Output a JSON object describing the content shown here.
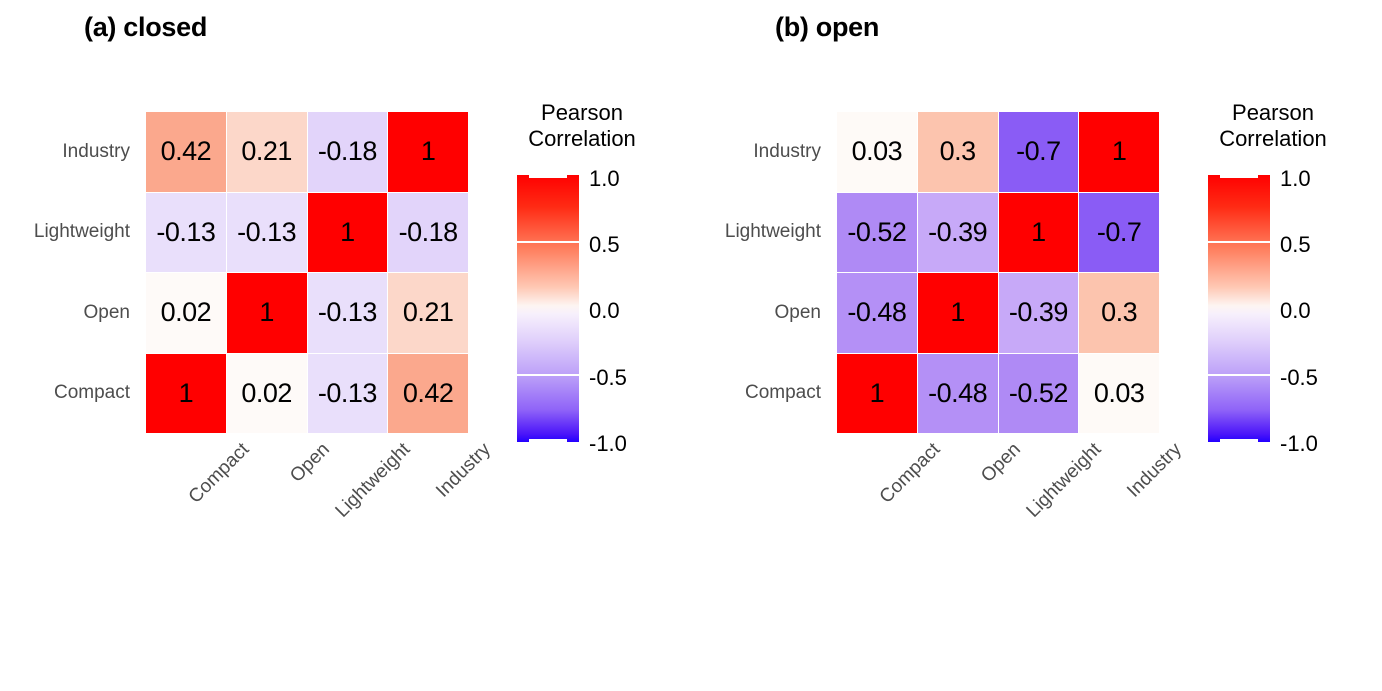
{
  "figure": {
    "background": "#ffffff",
    "panels": [
      {
        "id": "closed",
        "title": "(a) closed",
        "legend": {
          "title_line1": "Pearson",
          "title_line2": "Correlation",
          "ticks": [
            "1.0",
            "0.5",
            "0.0",
            "-0.5",
            "-1.0"
          ]
        }
      },
      {
        "id": "open",
        "title": "(b) open",
        "legend": {
          "title_line1": "Pearson",
          "title_line2": "Correlation",
          "ticks": [
            "1.0",
            "0.5",
            "0.0",
            "-0.5",
            "-1.0"
          ]
        }
      }
    ]
  },
  "chart_data": [
    {
      "type": "heatmap",
      "title": "(a) closed",
      "xlabel": "",
      "ylabel": "",
      "colorbar_label": "Pearson Correlation",
      "colorbar_range": [
        -1.0,
        1.0
      ],
      "colorbar_ticks": [
        1.0,
        0.5,
        0.0,
        -0.5,
        -1.0
      ],
      "colormap": "red-white-blue (positive=red, negative=blue/purple)",
      "x_categories": [
        "Compact",
        "Open",
        "Lightweight",
        "Industry"
      ],
      "y_categories": [
        "Industry",
        "Lightweight",
        "Open",
        "Compact"
      ],
      "rows": [
        {
          "label": "Industry",
          "values": [
            0.42,
            0.21,
            -0.18,
            1
          ],
          "display": [
            "0.42",
            "0.21",
            "-0.18",
            "1"
          ],
          "colors": [
            "#fba88d",
            "#fcd7c9",
            "#e2d4fa",
            "#ff0000"
          ]
        },
        {
          "label": "Lightweight",
          "values": [
            -0.13,
            -0.13,
            1,
            -0.18
          ],
          "display": [
            "-0.13",
            "-0.13",
            "1",
            "-0.18"
          ],
          "colors": [
            "#e9dffb",
            "#e9dffb",
            "#ff0000",
            "#e2d4fa"
          ]
        },
        {
          "label": "Open",
          "values": [
            0.02,
            1,
            -0.13,
            0.21
          ],
          "display": [
            "0.02",
            "1",
            "-0.13",
            "0.21"
          ],
          "colors": [
            "#fefaf8",
            "#ff0000",
            "#e9dffb",
            "#fcd7c9"
          ]
        },
        {
          "label": "Compact",
          "values": [
            1,
            0.02,
            -0.13,
            0.42
          ],
          "display": [
            "1",
            "0.02",
            "-0.13",
            "0.42"
          ],
          "colors": [
            "#ff0000",
            "#fefaf8",
            "#e9dffb",
            "#fba88d"
          ]
        }
      ]
    },
    {
      "type": "heatmap",
      "title": "(b) open",
      "xlabel": "",
      "ylabel": "",
      "colorbar_label": "Pearson Correlation",
      "colorbar_range": [
        -1.0,
        1.0
      ],
      "colorbar_ticks": [
        1.0,
        0.5,
        0.0,
        -0.5,
        -1.0
      ],
      "colormap": "red-white-blue (positive=red, negative=blue/purple)",
      "x_categories": [
        "Compact",
        "Open",
        "Lightweight",
        "Industry"
      ],
      "y_categories": [
        "Industry",
        "Lightweight",
        "Open",
        "Compact"
      ],
      "rows": [
        {
          "label": "Industry",
          "values": [
            0.03,
            0.3,
            -0.7,
            1
          ],
          "display": [
            "0.03",
            "0.3",
            "-0.7",
            "1"
          ],
          "colors": [
            "#fefaf7",
            "#fcc4ae",
            "#8a5cf5",
            "#ff0000"
          ]
        },
        {
          "label": "Lightweight",
          "values": [
            -0.52,
            -0.39,
            1,
            -0.7
          ],
          "display": [
            "-0.52",
            "-0.39",
            "1",
            "-0.7"
          ],
          "colors": [
            "#af8af5",
            "#c7a9f8",
            "#ff0000",
            "#8a5cf5"
          ]
        },
        {
          "label": "Open",
          "values": [
            -0.48,
            1,
            -0.39,
            0.3
          ],
          "display": [
            "-0.48",
            "1",
            "-0.39",
            "0.3"
          ],
          "colors": [
            "#b490f6",
            "#ff0000",
            "#c7a9f8",
            "#fcc4ae"
          ]
        },
        {
          "label": "Compact",
          "values": [
            1,
            -0.48,
            -0.52,
            0.03
          ],
          "display": [
            "1",
            "-0.48",
            "-0.52",
            "0.03"
          ],
          "colors": [
            "#ff0000",
            "#b490f6",
            "#af8af5",
            "#fefaf7"
          ]
        }
      ]
    }
  ]
}
